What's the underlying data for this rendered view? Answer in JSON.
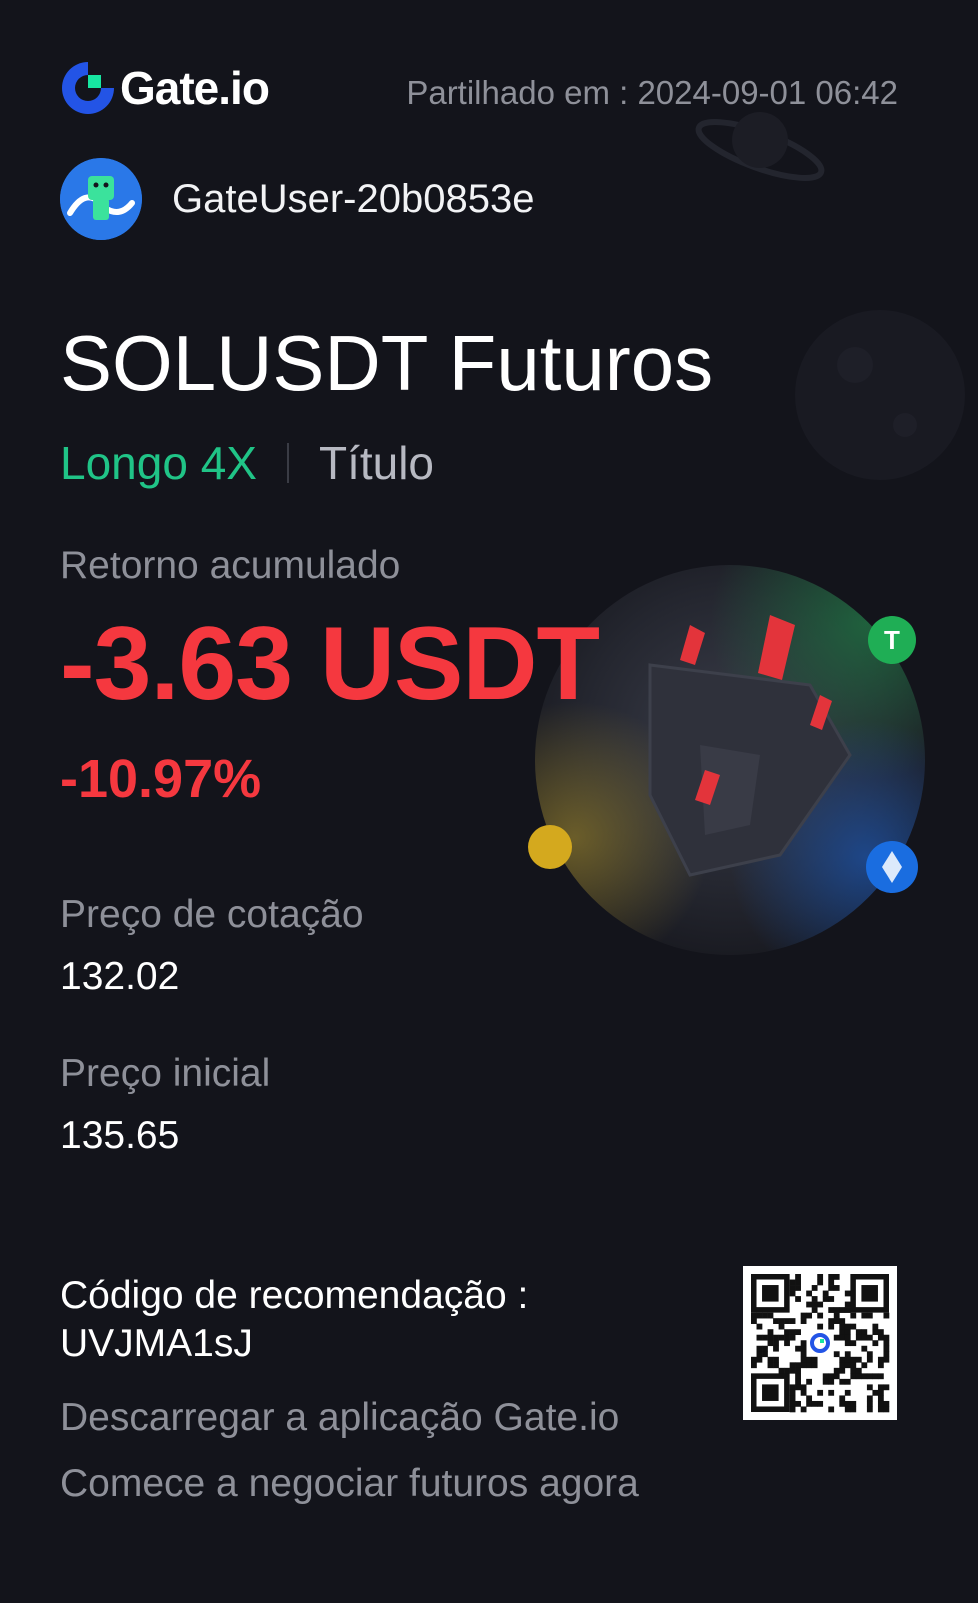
{
  "header": {
    "brand": "Gate.io",
    "shared_at": "Partilhado em : 2024-09-01 06:42"
  },
  "user": {
    "name": "GateUser-20b0853e"
  },
  "position": {
    "title": "SOLUSDT Futuros",
    "direction": "Longo 4X",
    "margin_mode": "Título",
    "return_label": "Retorno acumulado",
    "return_value": "-3.63 USDT",
    "return_pct": "-10.97%",
    "quote_label": "Preço de cotação",
    "quote_value": "132.02",
    "entry_label": "Preço inicial",
    "entry_value": "135.65"
  },
  "footer": {
    "referral_label": "Código de recomendação :",
    "referral_code": "UVJMA1sJ",
    "download_text": "Descarregar a aplicação Gate.io",
    "start_text": "Comece a negociar futuros agora"
  },
  "colors": {
    "background": "#13141b",
    "long_green": "#20c487",
    "loss_red": "#f5383f",
    "muted": "#8e9099",
    "brand_blue": "#2354e6",
    "brand_green": "#17e6a1"
  },
  "icons": [
    "gate-logo-icon",
    "avatar",
    "qr-code",
    "spaceship-illustration"
  ]
}
